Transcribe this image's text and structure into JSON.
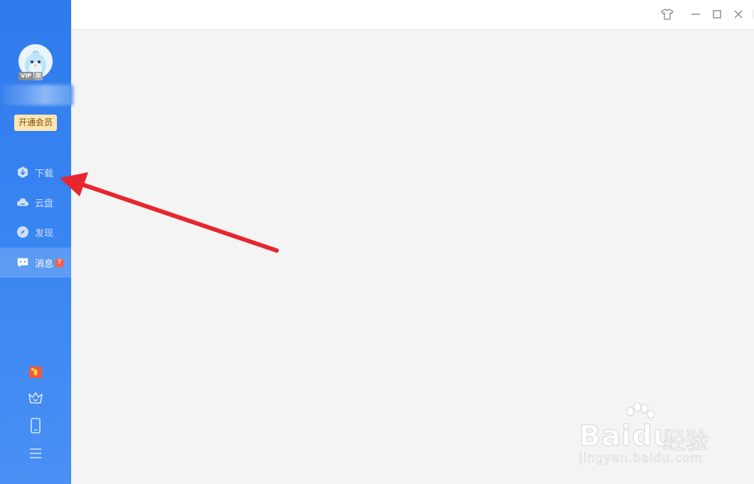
{
  "sidebar": {
    "vip_badge": {
      "tag": "VIP",
      "suffix": "年"
    },
    "open_vip_label": "开通会员",
    "nav_items": [
      {
        "label": "下载",
        "icon": "download-icon"
      },
      {
        "label": "云盘",
        "icon": "cloud-icon"
      },
      {
        "label": "发现",
        "icon": "compass-icon"
      },
      {
        "label": "消息",
        "icon": "message-icon",
        "badge": "7",
        "active": true
      }
    ],
    "bottom_icons": [
      "gift-icon",
      "crown-icon",
      "phone-icon",
      "menu-icon"
    ]
  },
  "titlebar": {
    "buttons": [
      "skin-icon",
      "minimize-icon",
      "maximize-icon",
      "close-icon"
    ]
  },
  "watermark": {
    "brand": "Baidu",
    "brand_suffix": "经验",
    "url": "jingyan.baidu.com"
  },
  "colors": {
    "sidebar": "#3a86f2",
    "active_item": "#5a9af5",
    "badge": "#f45f4a",
    "vip_button": "#fde6b3",
    "annotation_arrow": "#e8262e"
  }
}
